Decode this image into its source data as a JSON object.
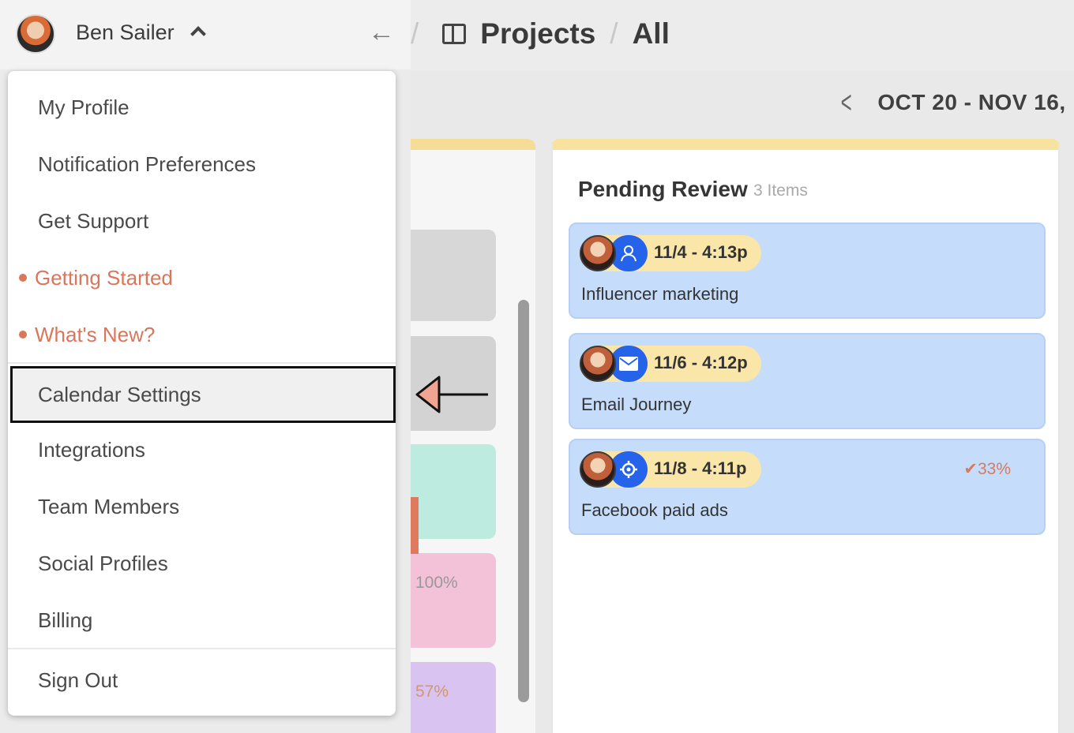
{
  "sidebar": {
    "user_name": "Ben Sailer",
    "menu": {
      "items": [
        {
          "label": "My Profile"
        },
        {
          "label": "Notification Preferences"
        },
        {
          "label": "Get Support"
        },
        {
          "label": "Getting Started",
          "highlight_dot": true
        },
        {
          "label": "What's New?",
          "highlight_dot": true
        },
        {
          "label": "Calendar Settings",
          "selected": true
        },
        {
          "label": "Integrations"
        },
        {
          "label": "Team Members"
        },
        {
          "label": "Social Profiles"
        },
        {
          "label": "Billing"
        },
        {
          "label": "Sign Out"
        }
      ]
    }
  },
  "header": {
    "breadcrumb": {
      "section": "Projects",
      "separator": "/",
      "view": "All"
    }
  },
  "calendar": {
    "date_range": "OCT 20 - NOV 16,"
  },
  "left_column": {
    "cards": [
      {
        "progress": ""
      },
      {
        "progress": ""
      },
      {
        "progress": ""
      },
      {
        "progress": "100%"
      },
      {
        "progress": "57%"
      }
    ]
  },
  "pending_column": {
    "title": "Pending Review",
    "count": "3 Items",
    "cards": [
      {
        "date": "11/4 - 4:13p",
        "title": "Influencer marketing",
        "type_icon": "influencer-icon",
        "progress": ""
      },
      {
        "date": "11/6 - 4:12p",
        "title": "Email Journey",
        "type_icon": "email-icon",
        "progress": ""
      },
      {
        "date": "11/8 - 4:11p",
        "title": "Facebook paid ads",
        "type_icon": "target-icon",
        "progress": "33%"
      }
    ]
  },
  "colors": {
    "accent": "#d9765b",
    "card_blue": "#c5dcfb",
    "badge_blue": "#2563eb",
    "date_pill": "#f9e6a8",
    "column_top": "#f7e29f"
  }
}
